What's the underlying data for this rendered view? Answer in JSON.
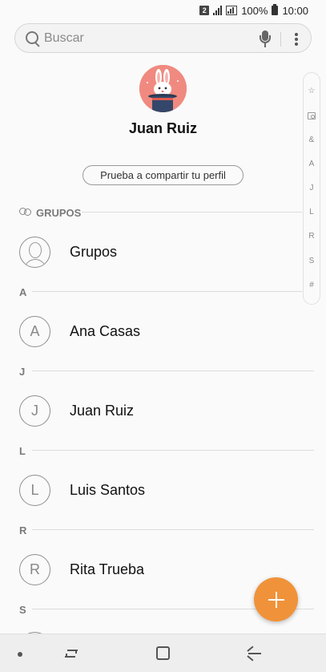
{
  "status_bar": {
    "sim": "2",
    "battery": "100%",
    "time": "10:00"
  },
  "search": {
    "placeholder": "Buscar"
  },
  "profile": {
    "name": "Juan Ruiz",
    "share_label": "Prueba a compartir tu perfil"
  },
  "index": [
    "☆",
    "book",
    "&",
    "A",
    "J",
    "L",
    "R",
    "S",
    "#"
  ],
  "sections": {
    "groups": "GRUPOS",
    "a": "A",
    "j": "J",
    "l": "L",
    "r": "R",
    "s": "S"
  },
  "contacts": {
    "groups_item": "Grupos",
    "ana": {
      "initial": "A",
      "name": "Ana Casas"
    },
    "juan": {
      "initial": "J",
      "name": "Juan Ruiz"
    },
    "luis": {
      "initial": "L",
      "name": "Luis Santos"
    },
    "rita": {
      "initial": "R",
      "name": "Rita Trueba"
    }
  },
  "colors": {
    "accent": "#f0923a",
    "avatar_bg": "#f08a80"
  }
}
